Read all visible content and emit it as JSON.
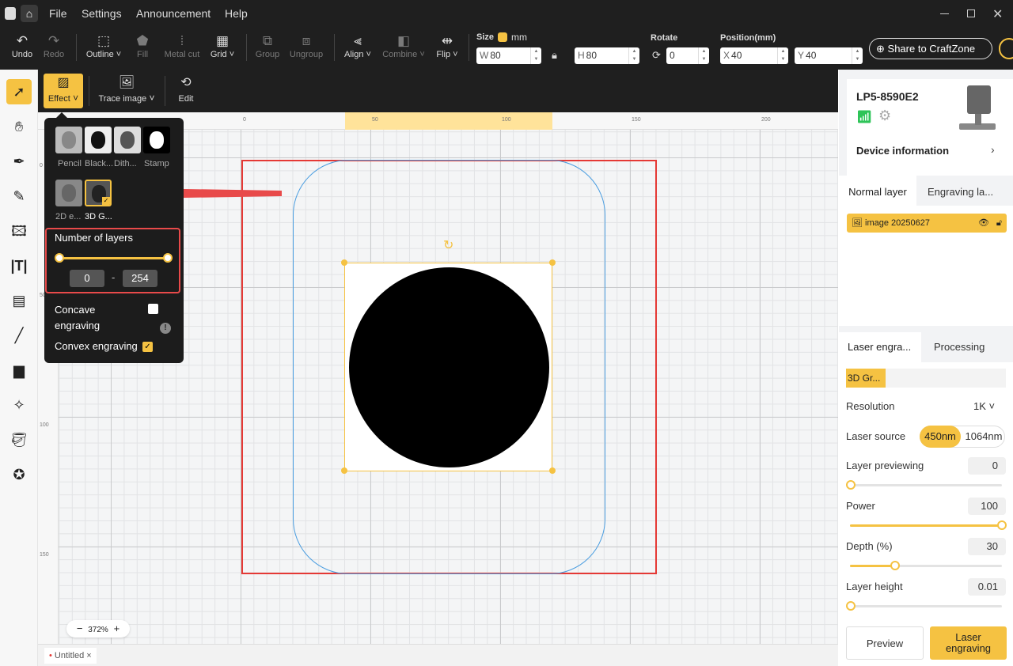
{
  "menu": {
    "file": "File",
    "settings": "Settings",
    "announcement": "Announcement",
    "help": "Help"
  },
  "toolbar": {
    "undo": "Undo",
    "redo": "Redo",
    "outline": "Outline",
    "fill": "Fill",
    "metal_cut": "Metal cut",
    "grid": "Grid",
    "group": "Group",
    "ungroup": "Ungroup",
    "align": "Align",
    "combine": "Combine",
    "flip": "Flip",
    "size_label": "Size",
    "unit": "mm",
    "w_prefix": "W",
    "w_value": "80",
    "h_prefix": "H",
    "h_value": "80",
    "rotate_label": "Rotate",
    "rotate_value": "0",
    "position_label": "Position(mm)",
    "x_prefix": "X",
    "x_value": "40",
    "y_prefix": "Y",
    "y_value": "40",
    "share": "Share to CraftZone"
  },
  "subtoolbar": {
    "effect": "Effect",
    "trace_image": "Trace image",
    "edit": "Edit"
  },
  "popup": {
    "effects": [
      {
        "label": "Pencil"
      },
      {
        "label": "Black..."
      },
      {
        "label": "Dith..."
      },
      {
        "label": "Stamp"
      }
    ],
    "effects2": [
      {
        "label": "2D e..."
      },
      {
        "label": "3D G..."
      }
    ],
    "layers_title": "Number of layers",
    "layers_min": "0",
    "layers_dash": "-",
    "layers_max": "254",
    "concave": "Concave engraving",
    "convex": "Convex engraving"
  },
  "ruler": {
    "top": [
      "0",
      "50",
      "100",
      "150",
      "200"
    ],
    "left": [
      "0",
      "50",
      "100",
      "150"
    ]
  },
  "zoom": {
    "minus": "−",
    "value": "372%",
    "plus": "+"
  },
  "tab": {
    "name": "Untitled",
    "close": "×"
  },
  "device": {
    "name": "LP5-8590E2",
    "info": "Device information"
  },
  "layers": {
    "normal": "Normal layer",
    "engraving": "Engraving la...",
    "item": "image 20250627"
  },
  "settings": {
    "tab_laser": "Laser engra...",
    "tab_processing": "Processing",
    "mode": "3D Gr...",
    "resolution_label": "Resolution",
    "resolution_value": "1K",
    "laser_source_label": "Laser source",
    "source_a": "450nm",
    "source_b": "1064nm",
    "previewing_label": "Layer previewing",
    "previewing_value": "0",
    "power_label": "Power",
    "power_value": "100",
    "depth_label": "Depth (%)",
    "depth_value": "30",
    "height_label": "Layer height",
    "height_value": "0.01",
    "preview": "Preview",
    "laser_engraving": "Laser engraving"
  },
  "colors": {
    "accent": "#f5c242",
    "selection": "#e53935",
    "arrow": "#e84a4a"
  }
}
